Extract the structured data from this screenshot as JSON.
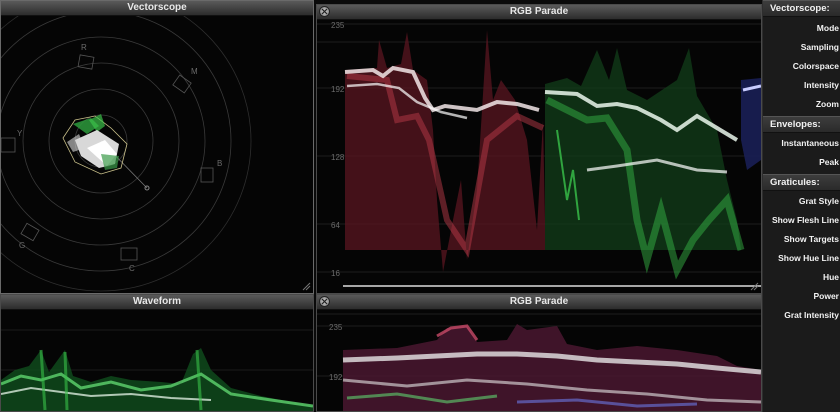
{
  "panels": {
    "vectorscope_title": "Vectorscope",
    "rgb_parade_top_title": "RGB Parade",
    "waveform_title": "Waveform",
    "rgb_parade_bottom_title": "RGB Parade"
  },
  "vectorscope_targets": {
    "r": "R",
    "mg": "M",
    "b": "B",
    "cy": "C",
    "g": "G",
    "yl": "Y"
  },
  "parade_scale_top": {
    "t235": "235",
    "t192": "192",
    "t128": "128",
    "t64": "64",
    "t16": "16"
  },
  "parade_scale_bottom": {
    "t235": "235",
    "t192": "192"
  },
  "sidebar": {
    "vectorscope_header": "Vectorscope:",
    "vectorscope_items": [
      "Mode",
      "Sampling",
      "Colorspace",
      "Intensity",
      "Zoom"
    ],
    "envelopes_header": "Envelopes:",
    "envelopes_items": [
      "Instantaneous",
      "Peak"
    ],
    "graticules_header": "Graticules:",
    "graticules_items": [
      "Grat Style",
      "Show Flesh Line",
      "Show Targets",
      "Show Hue Line",
      "Hue",
      "Power",
      "Grat Intensity"
    ]
  },
  "colors": {
    "red_trace": "#b83a48",
    "green_trace": "#39c24a",
    "blue_trace": "#4a5bd8",
    "panel_bg": "#050505",
    "titlebar": "#3c3c3c"
  }
}
